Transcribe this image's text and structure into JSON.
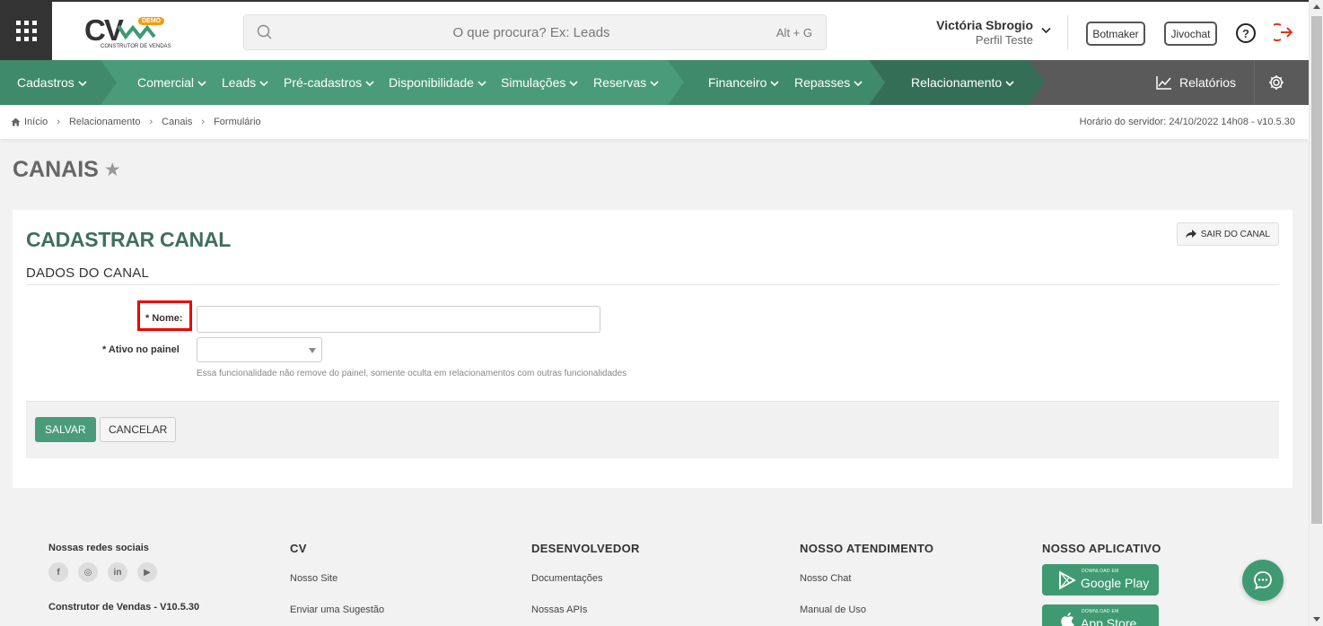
{
  "header": {
    "logo_text": "CV",
    "logo_badge": "DEMO",
    "logo_subtitle": "CONSTRUTOR DE VENDAS",
    "search_placeholder": "O que procura? Ex: Leads",
    "search_shortcut": "Alt + G",
    "user_name": "Victória Sbrogio",
    "user_profile": "Perfil Teste",
    "botmaker_label": "Botmaker",
    "jivochat_label": "Jivochat",
    "help_label": "?"
  },
  "nav": {
    "items": [
      {
        "label": "Cadastros"
      },
      {
        "label": "Comercial"
      },
      {
        "label": "Leads"
      },
      {
        "label": "Pré-cadastros"
      },
      {
        "label": "Disponibilidade"
      },
      {
        "label": "Simulações"
      },
      {
        "label": "Reservas"
      },
      {
        "label": "Financeiro"
      },
      {
        "label": "Repasses"
      },
      {
        "label": "Relacionamento"
      }
    ],
    "reports_label": "Relatórios",
    "colors": {
      "green_light": "#4a9b79",
      "green_mid": "#3f8a6a",
      "green_dark": "#356e57",
      "gray": "#5a5a5a"
    }
  },
  "breadcrumb": {
    "items": [
      "Início",
      "Relacionamento",
      "Canais",
      "Formulário"
    ],
    "server_time": "Horário do servidor: 24/10/2022 14h08 - v10.5.30"
  },
  "page": {
    "title": "CANAIS",
    "star": "★"
  },
  "form": {
    "title": "CADASTRAR CANAL",
    "exit_label": "SAIR DO CANAL",
    "section": "DADOS DO CANAL",
    "name_label": "* Nome:",
    "name_value": "",
    "active_label": "* Ativo no painel",
    "active_value": "",
    "active_help": "Essa funcionalidade não remove do painel, somente oculta em relacionamentos com outras funcionalidades",
    "save_label": "SALVAR",
    "cancel_label": "CANCELAR"
  },
  "footer": {
    "social_title": "Nossas redes sociais",
    "socials": [
      "f",
      "◎",
      "in",
      "▶"
    ],
    "version": "Construtor de Vendas - V10.5.30",
    "cv_title": "CV",
    "cv_links": [
      "Nosso Site",
      "Enviar uma Sugestão"
    ],
    "dev_title": "DESENVOLVEDOR",
    "dev_links": [
      "Documentações",
      "Nossas APIs"
    ],
    "support_title": "NOSSO ATENDIMENTO",
    "support_links": [
      "Nosso Chat",
      "Manual de Uso"
    ],
    "app_title": "NOSSO APLICATIVO",
    "google_small": "DOWNLOAD EM",
    "google_big": "Google Play",
    "apple_small": "DOWNLOAD EM",
    "apple_big": "App Store"
  }
}
